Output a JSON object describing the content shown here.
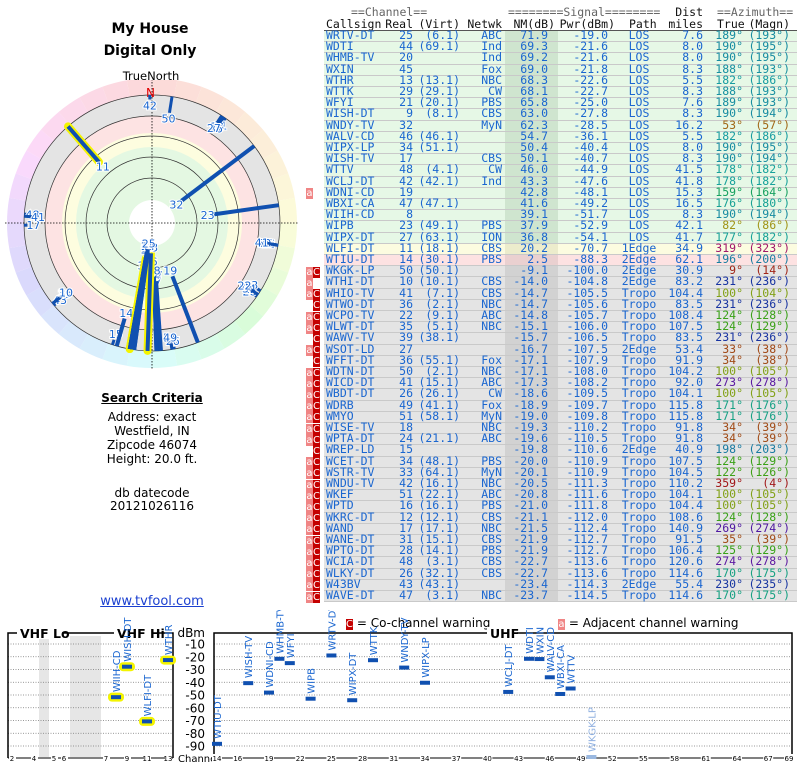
{
  "report": {
    "title": "My House",
    "subtitle": "Digital Only"
  },
  "polar": {
    "north_caption": "TrueNorth",
    "north_marker": "N"
  },
  "search": {
    "heading": "Search Criteria",
    "lines": [
      "Address: exact",
      "Westfield, IN",
      "Zipcode 46074",
      "Height: 20.0 ft."
    ],
    "datecode_label": "db datecode",
    "datecode": "20121026116"
  },
  "link": "www.tvfool.com",
  "table": {
    "group_headers": {
      "channel": "==Channel==",
      "signal": "========Signal========",
      "dist": "Dist",
      "azimuth": "==Azimuth=="
    },
    "headers": [
      "Callsign",
      "Real",
      "(Virt)",
      "Netwk",
      "NM(dB)",
      "Pwr(dBm)",
      "Path",
      "miles",
      "True",
      "(Magn)"
    ],
    "rows": [
      [
        "WRTV-DT",
        "25",
        "(6.1)",
        "ABC",
        "71.9",
        "-19.0",
        "LOS",
        "7.6",
        "189°",
        "(193°)",
        ""
      ],
      [
        "WDTI",
        "44",
        "(69.1)",
        "Ind",
        "69.3",
        "-21.6",
        "LOS",
        "8.0",
        "190°",
        "(195°)",
        ""
      ],
      [
        "WHMB-TV",
        "20",
        "",
        "Ind",
        "69.2",
        "-21.6",
        "LOS",
        "8.0",
        "190°",
        "(195°)",
        ""
      ],
      [
        "WXIN",
        "45",
        "",
        "Fox",
        "69.0",
        "-21.8",
        "LOS",
        "8.3",
        "188°",
        "(193°)",
        ""
      ],
      [
        "WTHR",
        "13",
        "(13.1)",
        "NBC",
        "68.3",
        "-22.6",
        "LOS",
        "5.5",
        "182°",
        "(186°)",
        ""
      ],
      [
        "WTTK",
        "29",
        "(29.1)",
        "CW",
        "68.1",
        "-22.7",
        "LOS",
        "8.3",
        "188°",
        "(193°)",
        ""
      ],
      [
        "WFYI",
        "21",
        "(20.1)",
        "PBS",
        "65.8",
        "-25.0",
        "LOS",
        "7.6",
        "189°",
        "(193°)",
        ""
      ],
      [
        "WISH-DT",
        "9",
        "(8.1)",
        "CBS",
        "63.0",
        "-27.8",
        "LOS",
        "8.3",
        "190°",
        "(194°)",
        ""
      ],
      [
        "WNDY-TV",
        "32",
        "",
        "MyN",
        "62.3",
        "-28.5",
        "LOS",
        "16.2",
        "53°",
        "(57°)",
        ""
      ],
      [
        "WALV-CD",
        "46",
        "(46.1)",
        "",
        "54.7",
        "-36.1",
        "LOS",
        "5.5",
        "182°",
        "(186°)",
        ""
      ],
      [
        "WIPX-LP",
        "34",
        "(51.1)",
        "",
        "50.4",
        "-40.4",
        "LOS",
        "8.0",
        "190°",
        "(195°)",
        ""
      ],
      [
        "WISH-TV",
        "17",
        "",
        "CBS",
        "50.1",
        "-40.7",
        "LOS",
        "8.3",
        "190°",
        "(194°)",
        ""
      ],
      [
        "WTTV",
        "48",
        "(4.1)",
        "CW",
        "46.0",
        "-44.9",
        "LOS",
        "41.5",
        "178°",
        "(182°)",
        ""
      ],
      [
        "WCLJ-DT",
        "42",
        "(42.1)",
        "Ind",
        "43.3",
        "-47.6",
        "LOS",
        "41.8",
        "178°",
        "(182°)",
        ""
      ],
      [
        "WDNI-CD",
        "19",
        "",
        "",
        "42.8",
        "-48.1",
        "LOS",
        "15.3",
        "159°",
        "(164°)",
        "a"
      ],
      [
        "WBXI-CA",
        "47",
        "(47.1)",
        "",
        "41.6",
        "-49.2",
        "LOS",
        "16.5",
        "176°",
        "(180°)",
        ""
      ],
      [
        "WIIH-CD",
        "8",
        "",
        "",
        "39.1",
        "-51.7",
        "LOS",
        "8.3",
        "190°",
        "(194°)",
        ""
      ],
      [
        "WIPB",
        "23",
        "(49.1)",
        "PBS",
        "37.9",
        "-52.9",
        "LOS",
        "42.1",
        "82°",
        "(86°)",
        ""
      ],
      [
        "WIPX-DT",
        "27",
        "(63.1)",
        "ION",
        "36.8",
        "-54.1",
        "LOS",
        "41.7",
        "177°",
        "(182°)",
        ""
      ],
      [
        "WLFI-DT",
        "11",
        "(18.1)",
        "CBS",
        "20.2",
        "-70.7",
        "1Edge",
        "34.9",
        "319°",
        "(323°)",
        ""
      ],
      [
        "WTIU-DT",
        "14",
        "(30.1)",
        "PBS",
        "2.5",
        "-88.3",
        "2Edge",
        "62.1",
        "196°",
        "(200°)",
        ""
      ],
      [
        "WKGK-LP",
        "50",
        "(50.1)",
        "",
        "-9.1",
        "-100.0",
        "2Edge",
        "30.9",
        "9°",
        "(14°)",
        "aC"
      ],
      [
        "WTHI-DT",
        "10",
        "(10.1)",
        "CBS",
        "-14.0",
        "-104.8",
        "2Edge",
        "83.2",
        "231°",
        "(236°)",
        "a"
      ],
      [
        "WHIO-TV",
        "41",
        "(7.1)",
        "CBS",
        "-14.7",
        "-105.5",
        "Tropo",
        "104.4",
        "100°",
        "(104°)",
        "aC"
      ],
      [
        "WTWO-DT",
        "36",
        "(2.1)",
        "NBC",
        "-14.7",
        "-105.6",
        "Tropo",
        "83.5",
        "231°",
        "(236°)",
        "C"
      ],
      [
        "WCPO-TV",
        "22",
        "(9.1)",
        "ABC",
        "-14.8",
        "-105.7",
        "Tropo",
        "108.4",
        "124°",
        "(128°)",
        "aC"
      ],
      [
        "WLWT-DT",
        "35",
        "(5.1)",
        "NBC",
        "-15.1",
        "-106.0",
        "Tropo",
        "107.5",
        "124°",
        "(129°)",
        "aC"
      ],
      [
        "WAWV-TV",
        "39",
        "(38.1)",
        "",
        "-15.7",
        "-106.5",
        "Tropo",
        "83.5",
        "231°",
        "(236°)",
        "C"
      ],
      [
        "WSOT-LD",
        "27",
        "",
        "",
        "-16.7",
        "-107.5",
        "2Edge",
        "53.4",
        "33°",
        "(38°)",
        "aC"
      ],
      [
        "WFFT-DT",
        "36",
        "(55.1)",
        "Fox",
        "-17.1",
        "-107.9",
        "Tropo",
        "91.9",
        "34°",
        "(38°)",
        "C"
      ],
      [
        "WDTN-DT",
        "50",
        "(2.1)",
        "NBC",
        "-17.1",
        "-108.0",
        "Tropo",
        "104.2",
        "100°",
        "(105°)",
        "aC"
      ],
      [
        "WICD-DT",
        "41",
        "(15.1)",
        "ABC",
        "-17.3",
        "-108.2",
        "Tropo",
        "92.0",
        "273°",
        "(278°)",
        "aC"
      ],
      [
        "WBDT-DT",
        "26",
        "(26.1)",
        "CW",
        "-18.6",
        "-109.5",
        "Tropo",
        "104.1",
        "100°",
        "(105°)",
        "aC"
      ],
      [
        "WDRB",
        "49",
        "(41.1)",
        "Fox",
        "-18.9",
        "-109.7",
        "Tropo",
        "115.8",
        "171°",
        "(176°)",
        "aC"
      ],
      [
        "WMYO",
        "51",
        "(58.1)",
        "MyN",
        "-19.0",
        "-109.8",
        "Tropo",
        "115.8",
        "171°",
        "(176°)",
        "aC"
      ],
      [
        "WISE-TV",
        "18",
        "",
        "NBC",
        "-19.3",
        "-110.2",
        "Tropo",
        "91.8",
        "34°",
        "(39°)",
        "aC"
      ],
      [
        "WPTA-DT",
        "24",
        "(21.1)",
        "ABC",
        "-19.6",
        "-110.5",
        "Tropo",
        "91.8",
        "34°",
        "(39°)",
        "aC"
      ],
      [
        "WREP-LD",
        "15",
        "",
        "",
        "-19.8",
        "-110.6",
        "2Edge",
        "40.9",
        "198°",
        "(203°)",
        "C"
      ],
      [
        "WCET-DT",
        "34",
        "(48.1)",
        "PBS",
        "-20.0",
        "-110.9",
        "Tropo",
        "107.5",
        "124°",
        "(129°)",
        "aC"
      ],
      [
        "WSTR-TV",
        "33",
        "(64.1)",
        "MyN",
        "-20.1",
        "-110.9",
        "Tropo",
        "104.5",
        "122°",
        "(126°)",
        "aC"
      ],
      [
        "WNDU-TV",
        "42",
        "(16.1)",
        "NBC",
        "-20.5",
        "-111.3",
        "Tropo",
        "110.2",
        "359°",
        "(4°)",
        "aC"
      ],
      [
        "WKEF",
        "51",
        "(22.1)",
        "ABC",
        "-20.8",
        "-111.6",
        "Tropo",
        "104.1",
        "100°",
        "(105°)",
        "aC"
      ],
      [
        "WPTD",
        "16",
        "(16.1)",
        "PBS",
        "-21.0",
        "-111.8",
        "Tropo",
        "104.4",
        "100°",
        "(105°)",
        "aC"
      ],
      [
        "WKRC-DT",
        "12",
        "(12.1)",
        "CBS",
        "-21.1",
        "-112.0",
        "Tropo",
        "108.6",
        "124°",
        "(128°)",
        "aC"
      ],
      [
        "WAND",
        "17",
        "(17.1)",
        "NBC",
        "-21.5",
        "-112.4",
        "Tropo",
        "140.9",
        "269°",
        "(274°)",
        "aC"
      ],
      [
        "WANE-DT",
        "31",
        "(15.1)",
        "CBS",
        "-21.9",
        "-112.7",
        "Tropo",
        "91.5",
        "35°",
        "(39°)",
        "aC"
      ],
      [
        "WPTO-DT",
        "28",
        "(14.1)",
        "PBS",
        "-21.9",
        "-112.7",
        "Tropo",
        "106.4",
        "125°",
        "(129°)",
        "aC"
      ],
      [
        "WCIA-DT",
        "48",
        "(3.1)",
        "CBS",
        "-22.7",
        "-113.6",
        "Tropo",
        "120.6",
        "274°",
        "(278°)",
        "aC"
      ],
      [
        "WLKY-DT",
        "26",
        "(32.1)",
        "CBS",
        "-22.7",
        "-113.6",
        "Tropo",
        "114.6",
        "170°",
        "(175°)",
        "aC"
      ],
      [
        "W43BV",
        "43",
        "(43.1)",
        "",
        "-23.4",
        "-114.3",
        "2Edge",
        "55.4",
        "230°",
        "(235°)",
        "aC"
      ],
      [
        "WAVE-DT",
        "47",
        "(3.1)",
        "NBC",
        "-23.7",
        "-114.5",
        "Tropo",
        "114.6",
        "170°",
        "(175°)",
        "aC"
      ]
    ]
  },
  "legend": {
    "co_badge": "C",
    "co_text": "= Co-channel warning",
    "adj_badge": "a",
    "adj_text": "= Adjacent channel warning"
  },
  "spectrum": {
    "vhf_lo_label": "VHF Lo",
    "vhf_hi_label": "VHF Hi",
    "uhf_label": "UHF",
    "dbm_label": "dBm",
    "channel_label": "Channel",
    "dbm_ticks": [
      "-10",
      "-20",
      "-30",
      "-40",
      "-50",
      "-60",
      "-70",
      "-80",
      "-90"
    ],
    "vhf_ticks": [
      "2",
      "4",
      "5",
      "6",
      "7",
      "9",
      "11",
      "13"
    ],
    "uhf_ticks": [
      "14",
      "16",
      "19",
      "22",
      "25",
      "28",
      "31",
      "34",
      "37",
      "40",
      "43",
      "46",
      "49",
      "52",
      "55",
      "58",
      "61",
      "64",
      "67",
      "69"
    ]
  },
  "colors": {
    "link_blue": "#1a66d0",
    "row_los": "#e6f8e6",
    "row_1edge": "#fcfce0",
    "row_2edge": "#fde2e2",
    "row_weak": "#e4e4e4",
    "co_channel": "#c40000",
    "adjacent": "#f08585",
    "vhf_highlight": "#f4f400"
  }
}
